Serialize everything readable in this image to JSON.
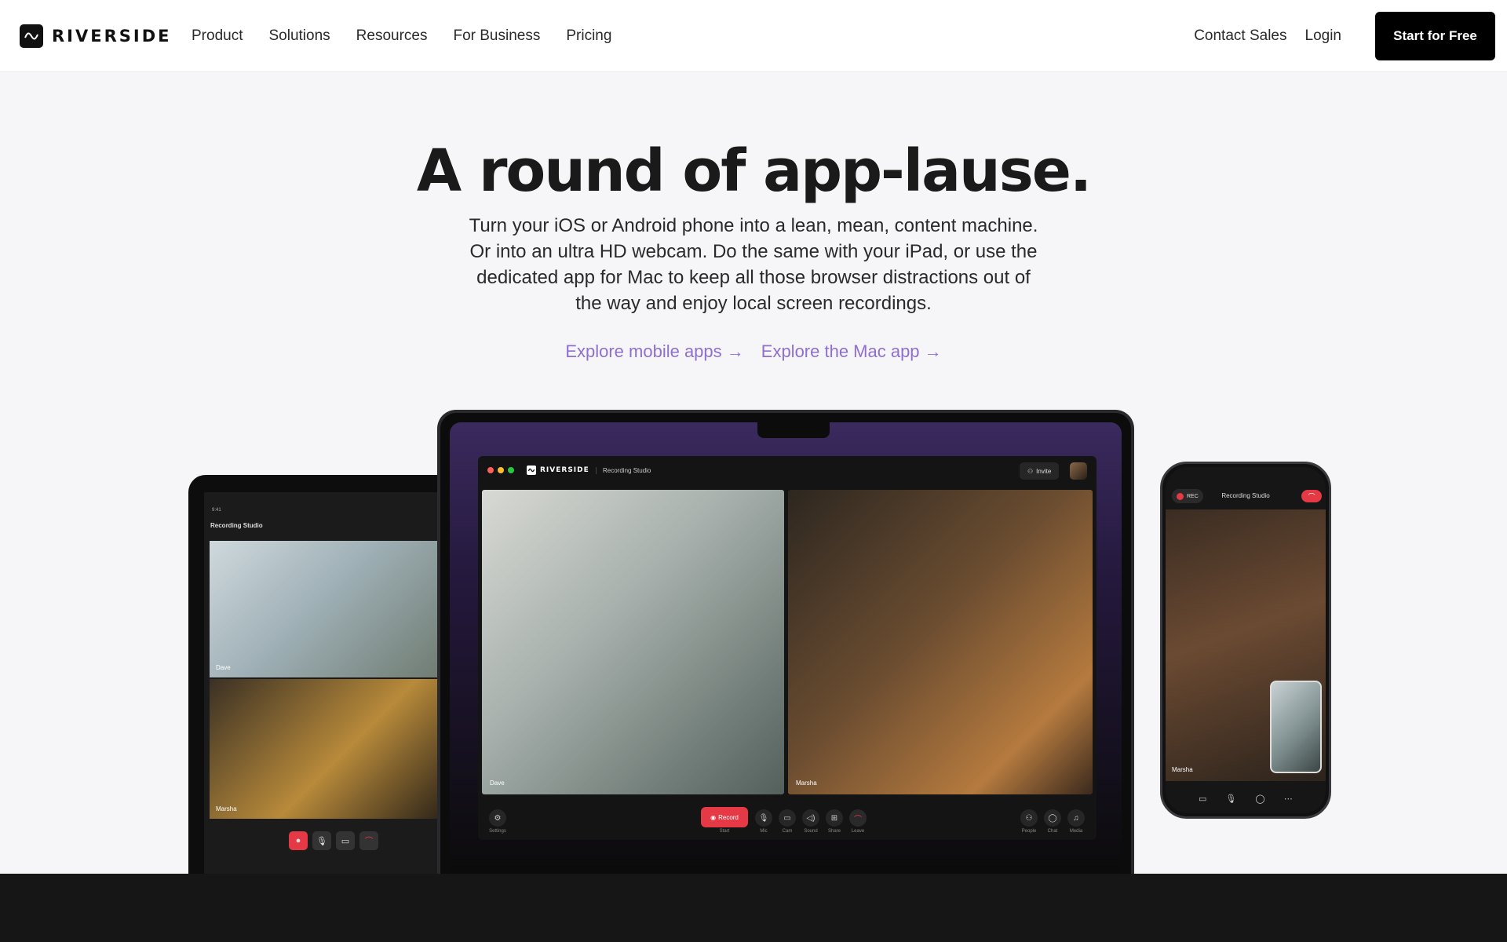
{
  "nav": {
    "brand": "RIVERSIDE",
    "links": [
      "Product",
      "Solutions",
      "Resources",
      "For Business",
      "Pricing"
    ],
    "contact": "Contact Sales",
    "login": "Login",
    "cta": "Start for Free"
  },
  "hero": {
    "title": "A round of app-lause.",
    "subtitle": "Turn your iOS or Android phone into a lean, mean, content machine. Or into an ultra HD webcam. Do the same with your iPad, or use the dedicated app for Mac to keep all those browser distractions out of the way and enjoy local screen recordings.",
    "link_mobile": "Explore mobile apps →",
    "link_mac": "Explore the Mac app →"
  },
  "tablet": {
    "time": "9:41",
    "title": "Recording Studio",
    "guest1": "Dave",
    "guest2": "Marsha"
  },
  "laptop": {
    "brand": "RIVERSIDE",
    "studio": "Recording Studio",
    "invite": "Invite",
    "guest1": "Dave",
    "guest2": "Marsha",
    "record": "Record",
    "labels": {
      "settings": "Settings",
      "start": "Start",
      "mic": "Mic",
      "cam": "Cam",
      "sound": "Sound",
      "share": "Share",
      "leave": "Leave",
      "people": "People",
      "chat": "Chat",
      "media": "Media"
    }
  },
  "phone": {
    "rec": "REC",
    "title": "Recording Studio",
    "guest": "Marsha"
  },
  "colors": {
    "accent": "#8f6fd0",
    "record": "#e53945",
    "cta_bg": "#000000"
  }
}
